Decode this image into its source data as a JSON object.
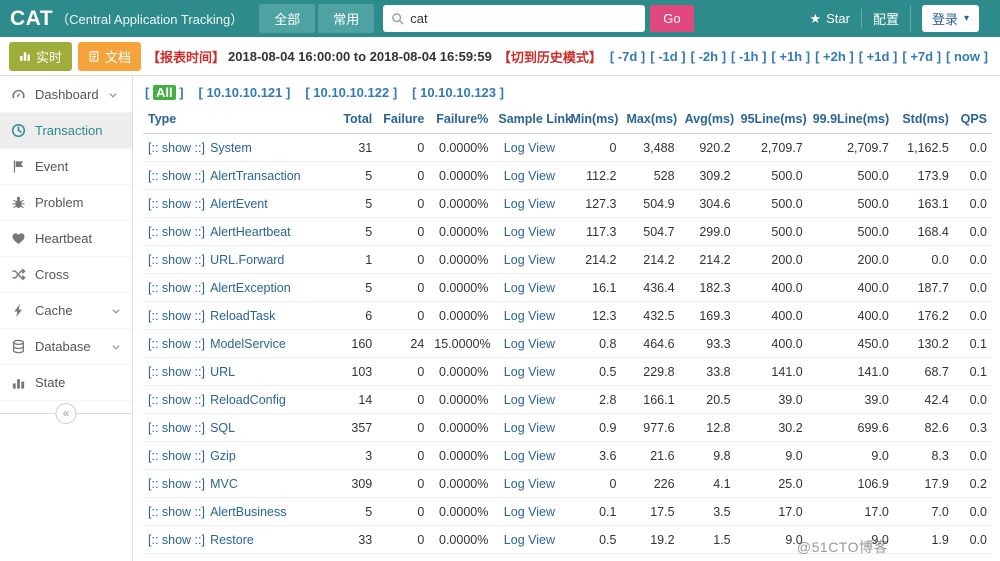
{
  "colors": {
    "header_teal": "#2E8B8B",
    "go_pink": "#E0487D",
    "realtime_olive": "#9FAE3B",
    "doc_orange": "#F5A43C",
    "danger_red": "#C9302C",
    "link_blue": "#337AB7",
    "table_header_blue": "#2A6496",
    "all_badge_green": "#44AD44"
  },
  "header": {
    "logo": "CAT",
    "subtitle": "（Central Application Tracking）",
    "tabs": [
      {
        "label": "全部"
      },
      {
        "label": "常用"
      }
    ],
    "search": {
      "value": "cat",
      "icon": "search-icon"
    },
    "go_label": "Go",
    "star_label": "Star",
    "star_icon": "star-icon",
    "config_label": "配置",
    "login_label": "登录"
  },
  "toolbar": {
    "realtime_label": "实时",
    "realtime_icon": "mini-chart-icon",
    "doc_label": "文档",
    "doc_icon": "doc-icon",
    "report_time_label": "【报表时间】",
    "report_time_value": "2018-08-04 16:00:00 to 2018-08-04 16:59:59",
    "history_mode_label": "【切到历史模式】",
    "time_links": [
      "[ -7d ]",
      "[ -1d ]",
      "[ -2h ]",
      "[ -1h ]",
      "[ +1h ]",
      "[ +2h ]",
      "[ +1d ]",
      "[ +7d ]",
      "[ now ]"
    ]
  },
  "sidebar": {
    "items": [
      {
        "label": "Dashboard",
        "icon": "gauge-icon",
        "expandable": true,
        "chevron": "inline"
      },
      {
        "label": "Transaction",
        "icon": "clock-icon",
        "active": true
      },
      {
        "label": "Event",
        "icon": "flag-icon"
      },
      {
        "label": "Problem",
        "icon": "bug-icon"
      },
      {
        "label": "Heartbeat",
        "icon": "heart-icon"
      },
      {
        "label": "Cross",
        "icon": "shuffle-icon"
      },
      {
        "label": "Cache",
        "icon": "bolt-icon",
        "expandable": true,
        "chevron": "right"
      },
      {
        "label": "Database",
        "icon": "database-icon",
        "expandable": true,
        "chevron": "right"
      },
      {
        "label": "State",
        "icon": "bar-chart-icon"
      }
    ],
    "collapse_glyph": "«"
  },
  "machines": {
    "items": [
      {
        "label": "All",
        "selected": true
      },
      {
        "label": "10.10.10.121"
      },
      {
        "label": "10.10.10.122"
      },
      {
        "label": "10.10.10.123"
      }
    ]
  },
  "table": {
    "columns": [
      "Type",
      "Total",
      "Failure",
      "Failure%",
      "Sample Link",
      "Min(ms)",
      "Max(ms)",
      "Avg(ms)",
      "95Line(ms)",
      "99.9Line(ms)",
      "Std(ms)",
      "QPS"
    ],
    "show_label": "[:: show ::]",
    "log_view_label": "Log View",
    "rows": [
      {
        "type": "System",
        "total": "31",
        "failure": "0",
        "failure_pct": "0.0000%",
        "min": "0",
        "max": "3,488",
        "avg": "920.2",
        "p95": "2,709.7",
        "p999": "2,709.7",
        "std": "1,162.5",
        "qps": "0.0"
      },
      {
        "type": "AlertTransaction",
        "total": "5",
        "failure": "0",
        "failure_pct": "0.0000%",
        "min": "112.2",
        "max": "528",
        "avg": "309.2",
        "p95": "500.0",
        "p999": "500.0",
        "std": "173.9",
        "qps": "0.0"
      },
      {
        "type": "AlertEvent",
        "total": "5",
        "failure": "0",
        "failure_pct": "0.0000%",
        "min": "127.3",
        "max": "504.9",
        "avg": "304.6",
        "p95": "500.0",
        "p999": "500.0",
        "std": "163.1",
        "qps": "0.0"
      },
      {
        "type": "AlertHeartbeat",
        "total": "5",
        "failure": "0",
        "failure_pct": "0.0000%",
        "min": "117.3",
        "max": "504.7",
        "avg": "299.0",
        "p95": "500.0",
        "p999": "500.0",
        "std": "168.4",
        "qps": "0.0"
      },
      {
        "type": "URL.Forward",
        "total": "1",
        "failure": "0",
        "failure_pct": "0.0000%",
        "min": "214.2",
        "max": "214.2",
        "avg": "214.2",
        "p95": "200.0",
        "p999": "200.0",
        "std": "0.0",
        "qps": "0.0"
      },
      {
        "type": "AlertException",
        "total": "5",
        "failure": "0",
        "failure_pct": "0.0000%",
        "min": "16.1",
        "max": "436.4",
        "avg": "182.3",
        "p95": "400.0",
        "p999": "400.0",
        "std": "187.7",
        "qps": "0.0"
      },
      {
        "type": "ReloadTask",
        "total": "6",
        "failure": "0",
        "failure_pct": "0.0000%",
        "min": "12.3",
        "max": "432.5",
        "avg": "169.3",
        "p95": "400.0",
        "p999": "400.0",
        "std": "176.2",
        "qps": "0.0"
      },
      {
        "type": "ModelService",
        "total": "160",
        "failure": "24",
        "failure_pct": "15.0000%",
        "min": "0.8",
        "max": "464.6",
        "avg": "93.3",
        "p95": "400.0",
        "p999": "450.0",
        "std": "130.2",
        "qps": "0.1"
      },
      {
        "type": "URL",
        "total": "103",
        "failure": "0",
        "failure_pct": "0.0000%",
        "min": "0.5",
        "max": "229.8",
        "avg": "33.8",
        "p95": "141.0",
        "p999": "141.0",
        "std": "68.7",
        "qps": "0.1"
      },
      {
        "type": "ReloadConfig",
        "total": "14",
        "failure": "0",
        "failure_pct": "0.0000%",
        "min": "2.8",
        "max": "166.1",
        "avg": "20.5",
        "p95": "39.0",
        "p999": "39.0",
        "std": "42.4",
        "qps": "0.0"
      },
      {
        "type": "SQL",
        "total": "357",
        "failure": "0",
        "failure_pct": "0.0000%",
        "min": "0.9",
        "max": "977.6",
        "avg": "12.8",
        "p95": "30.2",
        "p999": "699.6",
        "std": "82.6",
        "qps": "0.3"
      },
      {
        "type": "Gzip",
        "total": "3",
        "failure": "0",
        "failure_pct": "0.0000%",
        "min": "3.6",
        "max": "21.6",
        "avg": "9.8",
        "p95": "9.0",
        "p999": "9.0",
        "std": "8.3",
        "qps": "0.0"
      },
      {
        "type": "MVC",
        "total": "309",
        "failure": "0",
        "failure_pct": "0.0000%",
        "min": "0",
        "max": "226",
        "avg": "4.1",
        "p95": "25.0",
        "p999": "106.9",
        "std": "17.9",
        "qps": "0.2"
      },
      {
        "type": "AlertBusiness",
        "total": "5",
        "failure": "0",
        "failure_pct": "0.0000%",
        "min": "0.1",
        "max": "17.5",
        "avg": "3.5",
        "p95": "17.0",
        "p999": "17.0",
        "std": "7.0",
        "qps": "0.0"
      },
      {
        "type": "Restore",
        "total": "33",
        "failure": "0",
        "failure_pct": "0.0000%",
        "min": "0.5",
        "max": "19.2",
        "avg": "1.5",
        "p95": "9.0",
        "p999": "9.0",
        "std": "1.9",
        "qps": "0.0"
      }
    ]
  },
  "watermark": "@51CTO博客"
}
